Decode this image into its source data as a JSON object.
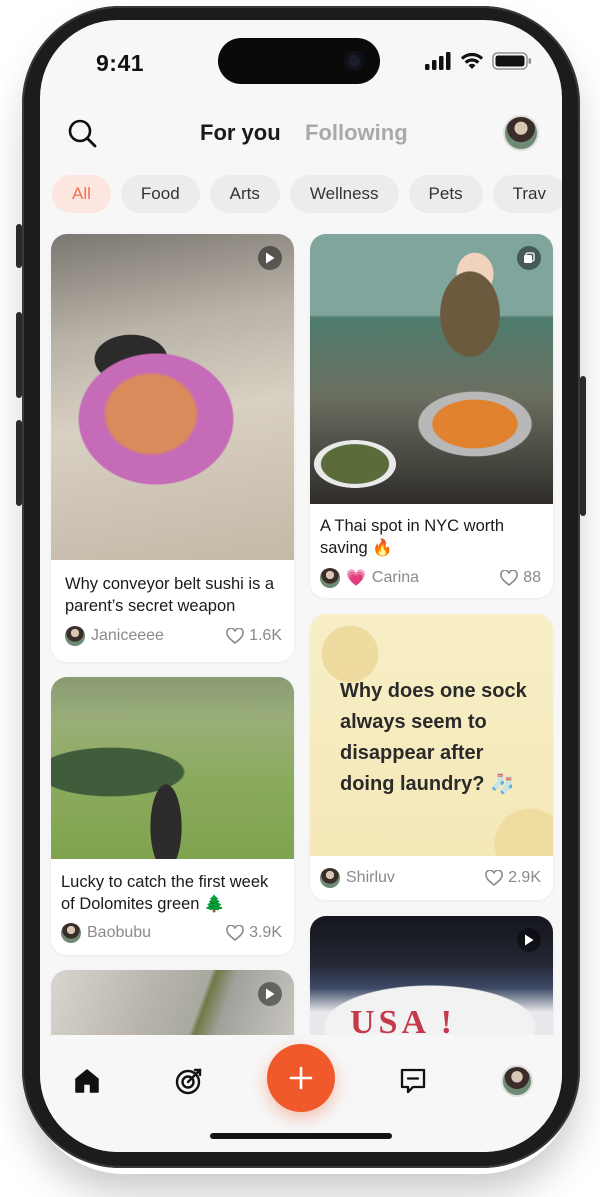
{
  "status_bar": {
    "time": "9:41"
  },
  "header": {
    "tabs": [
      {
        "label": "For you",
        "active": true
      },
      {
        "label": "Following",
        "active": false
      }
    ]
  },
  "categories": [
    "All",
    "Food",
    "Arts",
    "Wellness",
    "Pets",
    "Trav"
  ],
  "active_category": "All",
  "feed": {
    "left": [
      {
        "title": "Why conveyor belt sushi is a parent’s secret weapon",
        "author": "Janiceeee",
        "likes": "1.6K",
        "media": "video",
        "image": "conveyor belt sushi plate"
      },
      {
        "title": "Lucky to catch the first week of Dolomites green 🌲",
        "author": "Baobubu",
        "likes": "3.9K",
        "media": "photo",
        "image": "person overlooking green Dolomites valley"
      },
      {
        "media": "video",
        "image": "plastic bottle close-up"
      }
    ],
    "right": [
      {
        "title": "A Thai spot in NYC worth saving 🔥",
        "author_prefix": "💗",
        "author": "Carina",
        "likes": "88",
        "media": "gallery",
        "image": "woman with Thai hot pot"
      },
      {
        "text_post": "Why does one sock always seem to disappear after doing laundry? 🧦",
        "author": "Shirluv",
        "likes": "2.9K"
      },
      {
        "media": "video",
        "image": "USA birthday cake",
        "cake_text": "USA !"
      }
    ]
  },
  "colors": {
    "accent": "#f05a2b",
    "chip_active_bg": "#fde6df",
    "chip_active_text": "#f0704f",
    "tab_inactive": "#a9a9a9"
  },
  "bottom_nav": [
    "home-icon",
    "target-icon",
    "add-button",
    "messages-icon",
    "profile-avatar"
  ]
}
